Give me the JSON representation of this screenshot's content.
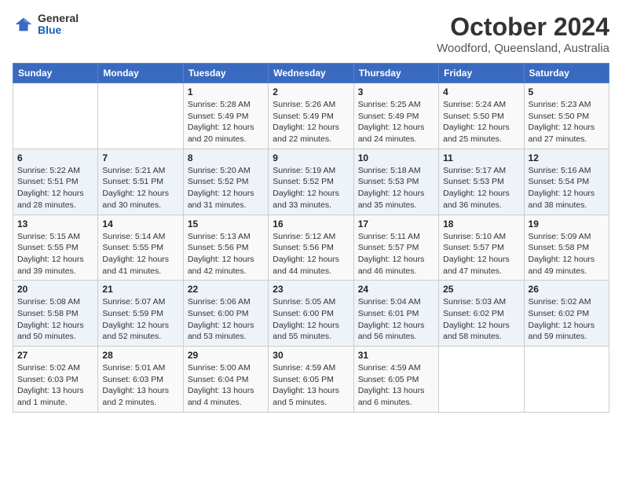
{
  "header": {
    "logo_general": "General",
    "logo_blue": "Blue",
    "title": "October 2024",
    "subtitle": "Woodford, Queensland, Australia"
  },
  "calendar": {
    "days_of_week": [
      "Sunday",
      "Monday",
      "Tuesday",
      "Wednesday",
      "Thursday",
      "Friday",
      "Saturday"
    ],
    "weeks": [
      [
        {
          "day": "",
          "sunrise": "",
          "sunset": "",
          "daylight": ""
        },
        {
          "day": "",
          "sunrise": "",
          "sunset": "",
          "daylight": ""
        },
        {
          "day": "1",
          "sunrise": "Sunrise: 5:28 AM",
          "sunset": "Sunset: 5:49 PM",
          "daylight": "Daylight: 12 hours and 20 minutes."
        },
        {
          "day": "2",
          "sunrise": "Sunrise: 5:26 AM",
          "sunset": "Sunset: 5:49 PM",
          "daylight": "Daylight: 12 hours and 22 minutes."
        },
        {
          "day": "3",
          "sunrise": "Sunrise: 5:25 AM",
          "sunset": "Sunset: 5:49 PM",
          "daylight": "Daylight: 12 hours and 24 minutes."
        },
        {
          "day": "4",
          "sunrise": "Sunrise: 5:24 AM",
          "sunset": "Sunset: 5:50 PM",
          "daylight": "Daylight: 12 hours and 25 minutes."
        },
        {
          "day": "5",
          "sunrise": "Sunrise: 5:23 AM",
          "sunset": "Sunset: 5:50 PM",
          "daylight": "Daylight: 12 hours and 27 minutes."
        }
      ],
      [
        {
          "day": "6",
          "sunrise": "Sunrise: 5:22 AM",
          "sunset": "Sunset: 5:51 PM",
          "daylight": "Daylight: 12 hours and 28 minutes."
        },
        {
          "day": "7",
          "sunrise": "Sunrise: 5:21 AM",
          "sunset": "Sunset: 5:51 PM",
          "daylight": "Daylight: 12 hours and 30 minutes."
        },
        {
          "day": "8",
          "sunrise": "Sunrise: 5:20 AM",
          "sunset": "Sunset: 5:52 PM",
          "daylight": "Daylight: 12 hours and 31 minutes."
        },
        {
          "day": "9",
          "sunrise": "Sunrise: 5:19 AM",
          "sunset": "Sunset: 5:52 PM",
          "daylight": "Daylight: 12 hours and 33 minutes."
        },
        {
          "day": "10",
          "sunrise": "Sunrise: 5:18 AM",
          "sunset": "Sunset: 5:53 PM",
          "daylight": "Daylight: 12 hours and 35 minutes."
        },
        {
          "day": "11",
          "sunrise": "Sunrise: 5:17 AM",
          "sunset": "Sunset: 5:53 PM",
          "daylight": "Daylight: 12 hours and 36 minutes."
        },
        {
          "day": "12",
          "sunrise": "Sunrise: 5:16 AM",
          "sunset": "Sunset: 5:54 PM",
          "daylight": "Daylight: 12 hours and 38 minutes."
        }
      ],
      [
        {
          "day": "13",
          "sunrise": "Sunrise: 5:15 AM",
          "sunset": "Sunset: 5:55 PM",
          "daylight": "Daylight: 12 hours and 39 minutes."
        },
        {
          "day": "14",
          "sunrise": "Sunrise: 5:14 AM",
          "sunset": "Sunset: 5:55 PM",
          "daylight": "Daylight: 12 hours and 41 minutes."
        },
        {
          "day": "15",
          "sunrise": "Sunrise: 5:13 AM",
          "sunset": "Sunset: 5:56 PM",
          "daylight": "Daylight: 12 hours and 42 minutes."
        },
        {
          "day": "16",
          "sunrise": "Sunrise: 5:12 AM",
          "sunset": "Sunset: 5:56 PM",
          "daylight": "Daylight: 12 hours and 44 minutes."
        },
        {
          "day": "17",
          "sunrise": "Sunrise: 5:11 AM",
          "sunset": "Sunset: 5:57 PM",
          "daylight": "Daylight: 12 hours and 46 minutes."
        },
        {
          "day": "18",
          "sunrise": "Sunrise: 5:10 AM",
          "sunset": "Sunset: 5:57 PM",
          "daylight": "Daylight: 12 hours and 47 minutes."
        },
        {
          "day": "19",
          "sunrise": "Sunrise: 5:09 AM",
          "sunset": "Sunset: 5:58 PM",
          "daylight": "Daylight: 12 hours and 49 minutes."
        }
      ],
      [
        {
          "day": "20",
          "sunrise": "Sunrise: 5:08 AM",
          "sunset": "Sunset: 5:58 PM",
          "daylight": "Daylight: 12 hours and 50 minutes."
        },
        {
          "day": "21",
          "sunrise": "Sunrise: 5:07 AM",
          "sunset": "Sunset: 5:59 PM",
          "daylight": "Daylight: 12 hours and 52 minutes."
        },
        {
          "day": "22",
          "sunrise": "Sunrise: 5:06 AM",
          "sunset": "Sunset: 6:00 PM",
          "daylight": "Daylight: 12 hours and 53 minutes."
        },
        {
          "day": "23",
          "sunrise": "Sunrise: 5:05 AM",
          "sunset": "Sunset: 6:00 PM",
          "daylight": "Daylight: 12 hours and 55 minutes."
        },
        {
          "day": "24",
          "sunrise": "Sunrise: 5:04 AM",
          "sunset": "Sunset: 6:01 PM",
          "daylight": "Daylight: 12 hours and 56 minutes."
        },
        {
          "day": "25",
          "sunrise": "Sunrise: 5:03 AM",
          "sunset": "Sunset: 6:02 PM",
          "daylight": "Daylight: 12 hours and 58 minutes."
        },
        {
          "day": "26",
          "sunrise": "Sunrise: 5:02 AM",
          "sunset": "Sunset: 6:02 PM",
          "daylight": "Daylight: 12 hours and 59 minutes."
        }
      ],
      [
        {
          "day": "27",
          "sunrise": "Sunrise: 5:02 AM",
          "sunset": "Sunset: 6:03 PM",
          "daylight": "Daylight: 13 hours and 1 minute."
        },
        {
          "day": "28",
          "sunrise": "Sunrise: 5:01 AM",
          "sunset": "Sunset: 6:03 PM",
          "daylight": "Daylight: 13 hours and 2 minutes."
        },
        {
          "day": "29",
          "sunrise": "Sunrise: 5:00 AM",
          "sunset": "Sunset: 6:04 PM",
          "daylight": "Daylight: 13 hours and 4 minutes."
        },
        {
          "day": "30",
          "sunrise": "Sunrise: 4:59 AM",
          "sunset": "Sunset: 6:05 PM",
          "daylight": "Daylight: 13 hours and 5 minutes."
        },
        {
          "day": "31",
          "sunrise": "Sunrise: 4:59 AM",
          "sunset": "Sunset: 6:05 PM",
          "daylight": "Daylight: 13 hours and 6 minutes."
        },
        {
          "day": "",
          "sunrise": "",
          "sunset": "",
          "daylight": ""
        },
        {
          "day": "",
          "sunrise": "",
          "sunset": "",
          "daylight": ""
        }
      ]
    ]
  }
}
